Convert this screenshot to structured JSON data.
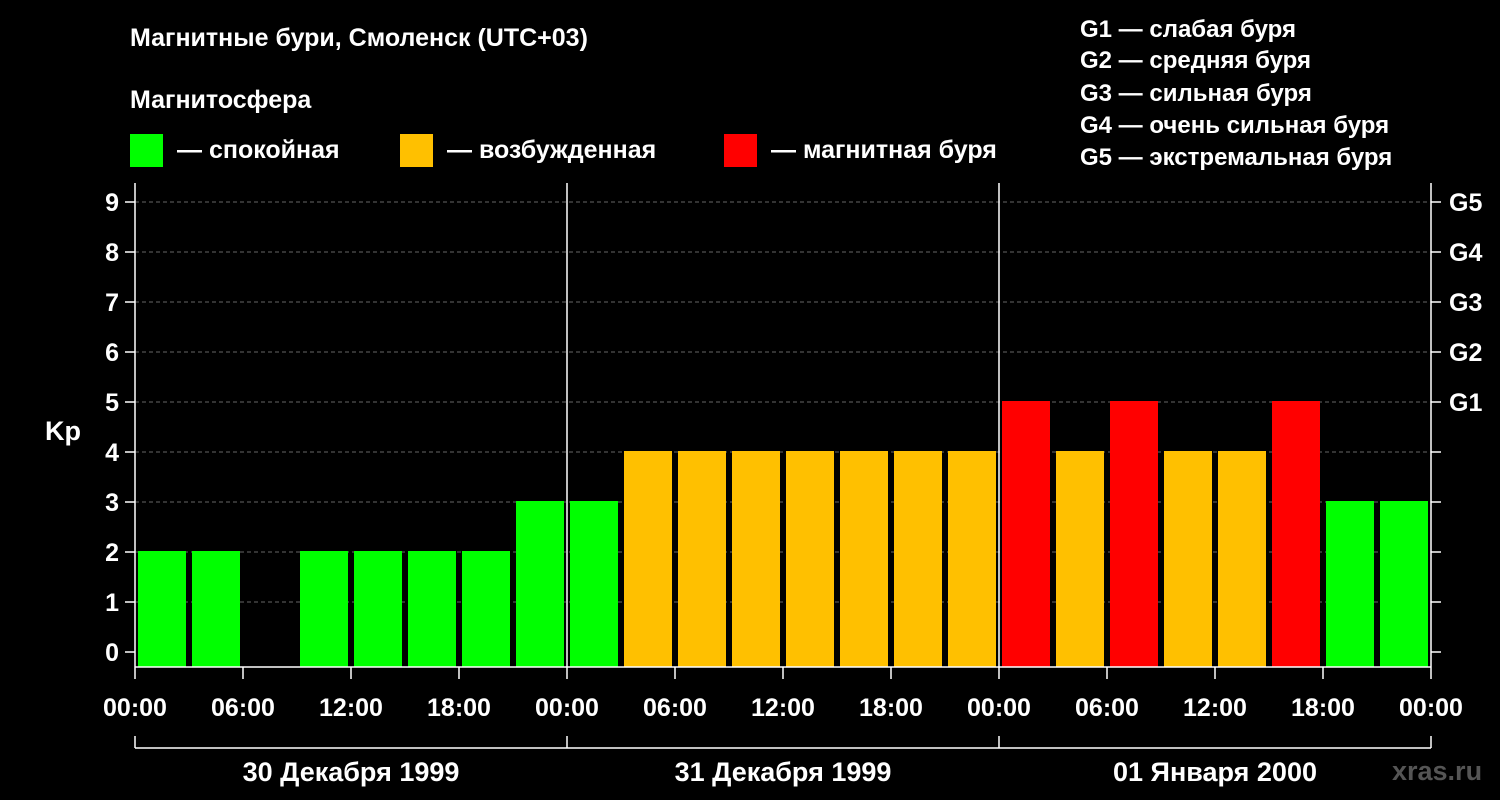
{
  "header": {
    "title": "Магнитные бури, Смоленск (UTC+03)",
    "magnetosphere_label": "Магнитосфера"
  },
  "legend": [
    {
      "label": "— спокойная",
      "color": "#00ff00"
    },
    {
      "label": "— возбужденная",
      "color": "#ffc000"
    },
    {
      "label": "— магнитная буря",
      "color": "#ff0000"
    }
  ],
  "g_scale_list": [
    "G1 — слабая буря",
    "G2 — средняя буря",
    "G3 — сильная буря",
    "G4 — очень сильная буря",
    "G5 — экстремальная буря"
  ],
  "watermark": "xras.ru",
  "chart_data": {
    "type": "bar",
    "ylabel": "Kp",
    "ylim": [
      0,
      9
    ],
    "yticks": [
      "0",
      "1",
      "2",
      "3",
      "4",
      "5",
      "6",
      "7",
      "8",
      "9"
    ],
    "right_axis_labels": [
      {
        "kp": 5,
        "label": "G1"
      },
      {
        "kp": 6,
        "label": "G2"
      },
      {
        "kp": 7,
        "label": "G3"
      },
      {
        "kp": 8,
        "label": "G4"
      },
      {
        "kp": 9,
        "label": "G5"
      }
    ],
    "xtick_labels": [
      "00:00",
      "06:00",
      "12:00",
      "18:00",
      "00:00",
      "06:00",
      "12:00",
      "18:00",
      "00:00",
      "06:00",
      "12:00",
      "18:00",
      "00:00"
    ],
    "day_labels": [
      "30 Декабря 1999",
      "31 Декабря 1999",
      "01 Января 2000"
    ],
    "interval_hours": 3,
    "values": [
      2,
      2,
      0,
      2,
      2,
      2,
      2,
      3,
      3,
      4,
      4,
      4,
      4,
      4,
      4,
      4,
      5,
      4,
      5,
      4,
      4,
      5,
      3,
      3
    ],
    "colors": {
      "quiet": "#00ff00",
      "active": "#ffc000",
      "storm": "#ff0000"
    },
    "grid": "dashed horizontal",
    "legend_placement": "top"
  }
}
